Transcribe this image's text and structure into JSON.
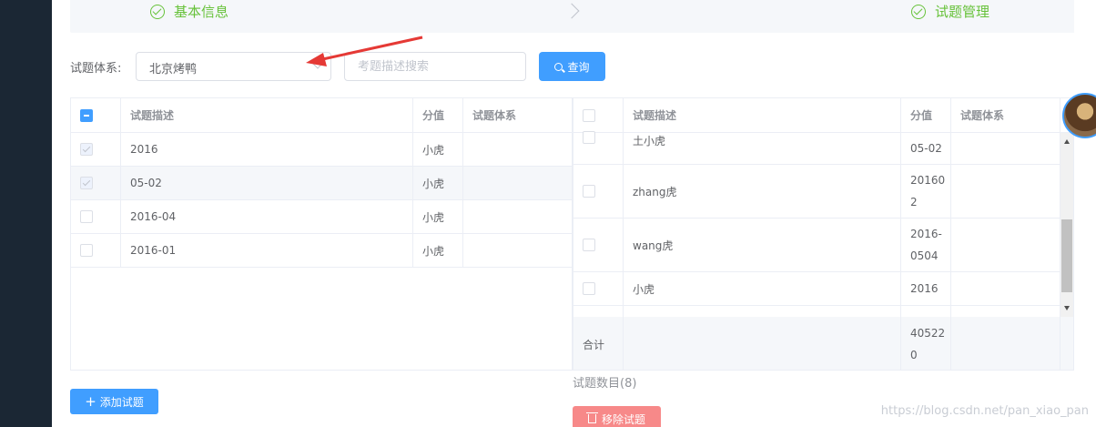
{
  "steps": [
    {
      "label": "基本信息",
      "icon": "check-circle-icon"
    },
    {
      "label": "试题管理",
      "icon": "check-circle-icon"
    }
  ],
  "filter": {
    "label": "试题体系:",
    "selected": "北京烤鸭",
    "search_placeholder": "考题描述搜索",
    "query_label": "查询"
  },
  "left_table": {
    "columns": [
      "试题描述",
      "分值",
      "试题体系"
    ],
    "rows": [
      {
        "desc": "2016",
        "score": "小虎",
        "system": "",
        "checked": true
      },
      {
        "desc": "05-02",
        "score": "小虎",
        "system": "",
        "checked": true
      },
      {
        "desc": "2016-04",
        "score": "小虎",
        "system": "",
        "checked": false
      },
      {
        "desc": "2016-01",
        "score": "小虎",
        "system": "",
        "checked": false
      }
    ]
  },
  "right_table": {
    "columns": [
      "试题描述",
      "分值",
      "试题体系"
    ],
    "rows": [
      {
        "desc": "土小虎",
        "score": "05-02",
        "system": ""
      },
      {
        "desc": "zhang虎",
        "score": "20160\n2",
        "system": ""
      },
      {
        "desc": "wang虎",
        "score": "2016-\n0504",
        "system": ""
      },
      {
        "desc": "小虎",
        "score": "2016",
        "system": ""
      }
    ],
    "total_label": "合计",
    "total_value": "40522\n0"
  },
  "count_text": "试题数目(8)",
  "add_button": "添加试题",
  "remove_button": "移除试题",
  "watermark": "https://blog.csdn.net/pan_xiao_pan",
  "colors": {
    "primary": "#409eff",
    "success": "#67c23a",
    "danger": "#f78989",
    "sidebar": "#1b2734"
  }
}
